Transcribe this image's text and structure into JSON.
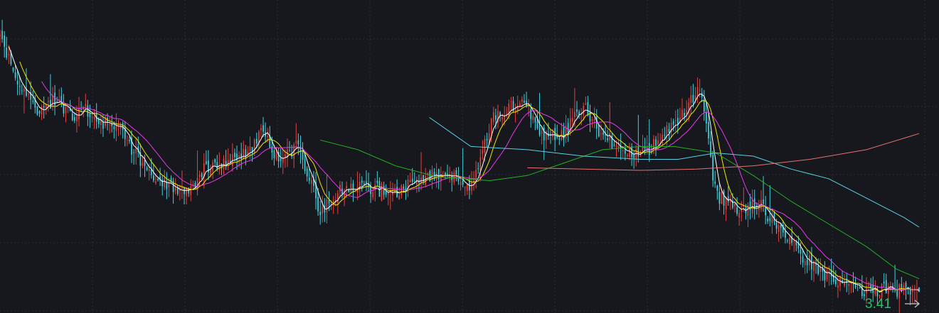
{
  "chart_data": {
    "type": "candlestick",
    "bars": 420,
    "last_price_label": "3.41",
    "ylim": [
      3.2,
      7.6
    ],
    "grid": true,
    "colors": {
      "background": "#16181d",
      "grid": "#2a2d33",
      "up": "#e8413b",
      "down": "#3fd2e0",
      "ma5": "#ffffff",
      "ma10": "#f2e600",
      "ma20": "#e83ae8",
      "ma60": "#22b022",
      "ma120": "#5ad2e6",
      "ma250": "#e87070"
    },
    "moving_averages": [
      {
        "period": 5,
        "color": "ma5"
      },
      {
        "period": 10,
        "color": "ma10"
      },
      {
        "period": 20,
        "color": "ma20"
      },
      {
        "period": 60,
        "color": "ma60"
      },
      {
        "period": 120,
        "color": "ma120"
      },
      {
        "period": 250,
        "color": "ma250"
      }
    ],
    "close_path": [
      [
        0,
        7.25
      ],
      [
        6,
        6.8
      ],
      [
        14,
        6.3
      ],
      [
        22,
        6.05
      ],
      [
        30,
        6.3
      ],
      [
        38,
        6.0
      ],
      [
        45,
        6.15
      ],
      [
        52,
        5.95
      ],
      [
        62,
        5.85
      ],
      [
        78,
        5.2
      ],
      [
        90,
        4.95
      ],
      [
        100,
        4.85
      ],
      [
        108,
        5.2
      ],
      [
        118,
        5.3
      ],
      [
        132,
        5.45
      ],
      [
        140,
        5.8
      ],
      [
        148,
        5.3
      ],
      [
        158,
        5.55
      ],
      [
        170,
        4.55
      ],
      [
        184,
        4.95
      ],
      [
        196,
        4.9
      ],
      [
        210,
        4.85
      ],
      [
        224,
        5.05
      ],
      [
        236,
        5.15
      ],
      [
        250,
        4.95
      ],
      [
        262,
        6.0
      ],
      [
        276,
        6.25
      ],
      [
        290,
        5.7
      ],
      [
        300,
        5.75
      ],
      [
        310,
        6.2
      ],
      [
        318,
        5.8
      ],
      [
        332,
        5.45
      ],
      [
        344,
        5.5
      ],
      [
        352,
        5.75
      ],
      [
        362,
        6.0
      ],
      [
        372,
        6.55
      ],
      [
        380,
        4.8
      ],
      [
        392,
        4.55
      ],
      [
        402,
        4.7
      ],
      [
        410,
        4.4
      ],
      [
        424,
        3.9
      ],
      [
        436,
        3.6
      ],
      [
        450,
        3.38
      ],
      [
        462,
        3.3
      ],
      [
        474,
        3.35
      ],
      [
        482,
        3.28
      ],
      [
        486,
        3.35
      ],
      [
        488,
        3.3
      ]
    ],
    "ma_segments": {
      "ma60": [
        [
          170,
          5.65
        ],
        [
          190,
          5.5
        ],
        [
          210,
          5.25
        ],
        [
          232,
          5.08
        ],
        [
          260,
          5.02
        ],
        [
          280,
          5.1
        ],
        [
          300,
          5.3
        ],
        [
          320,
          5.5
        ],
        [
          340,
          5.55
        ],
        [
          358,
          5.55
        ],
        [
          380,
          5.45
        ],
        [
          400,
          5.1
        ],
        [
          420,
          4.7
        ],
        [
          440,
          4.35
        ],
        [
          460,
          4.0
        ],
        [
          476,
          3.65
        ],
        [
          488,
          3.5
        ]
      ],
      "ma120": [
        [
          228,
          6.0
        ],
        [
          250,
          5.55
        ],
        [
          280,
          5.5
        ],
        [
          310,
          5.4
        ],
        [
          340,
          5.35
        ],
        [
          360,
          5.35
        ],
        [
          380,
          5.45
        ],
        [
          400,
          5.4
        ],
        [
          420,
          5.2
        ],
        [
          440,
          5.05
        ],
        [
          460,
          4.75
        ],
        [
          480,
          4.45
        ],
        [
          488,
          4.3
        ]
      ],
      "ma250": [
        [
          488,
          5.75
        ],
        [
          460,
          5.5
        ],
        [
          430,
          5.35
        ],
        [
          400,
          5.25
        ],
        [
          370,
          5.2
        ],
        [
          340,
          5.18
        ],
        [
          310,
          5.2
        ],
        [
          280,
          5.22
        ]
      ]
    }
  }
}
